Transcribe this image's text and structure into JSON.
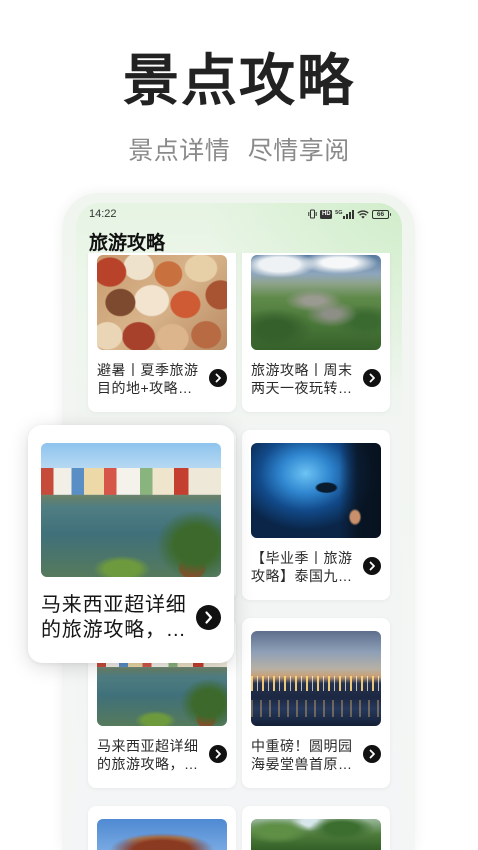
{
  "promo": {
    "title": "景点攻略",
    "subtitle": "景点详情 尽情享阅"
  },
  "status_bar": {
    "time": "14:22",
    "hd_label": "HD",
    "network_label": "5G",
    "battery_level": "66",
    "icons": [
      "vibrate-icon",
      "hd-icon",
      "signal-icon",
      "wifi-icon",
      "battery-icon"
    ]
  },
  "screen": {
    "title": "旅游攻略",
    "articles": [
      {
        "title_lines": [
          "避暑丨夏季旅游",
          "目的地+攻略…"
        ]
      },
      {
        "title_lines": [
          "旅游攻略丨周末",
          "两天一夜玩转…"
        ]
      },
      {
        "title_lines": [
          "【毕业季丨旅游",
          "攻略】泰国九…"
        ]
      },
      {
        "title_lines": [
          "马来西亚超详细",
          "的旅游攻略，…"
        ]
      },
      {
        "title_lines": [
          "中重磅！圆明园",
          "海晏堂兽首原…"
        ]
      }
    ]
  },
  "featured_card": {
    "title_lines": [
      "马来西亚超详细",
      "的旅游攻略，…"
    ]
  },
  "icons": {
    "article_open": "chevron-right-icon"
  },
  "colors": {
    "title_text": "#222222",
    "subtitle_text": "#8a8a8a",
    "button_fill": "#111111",
    "screen_tint": "#e4f3e0",
    "card_background": "#ffffff"
  }
}
